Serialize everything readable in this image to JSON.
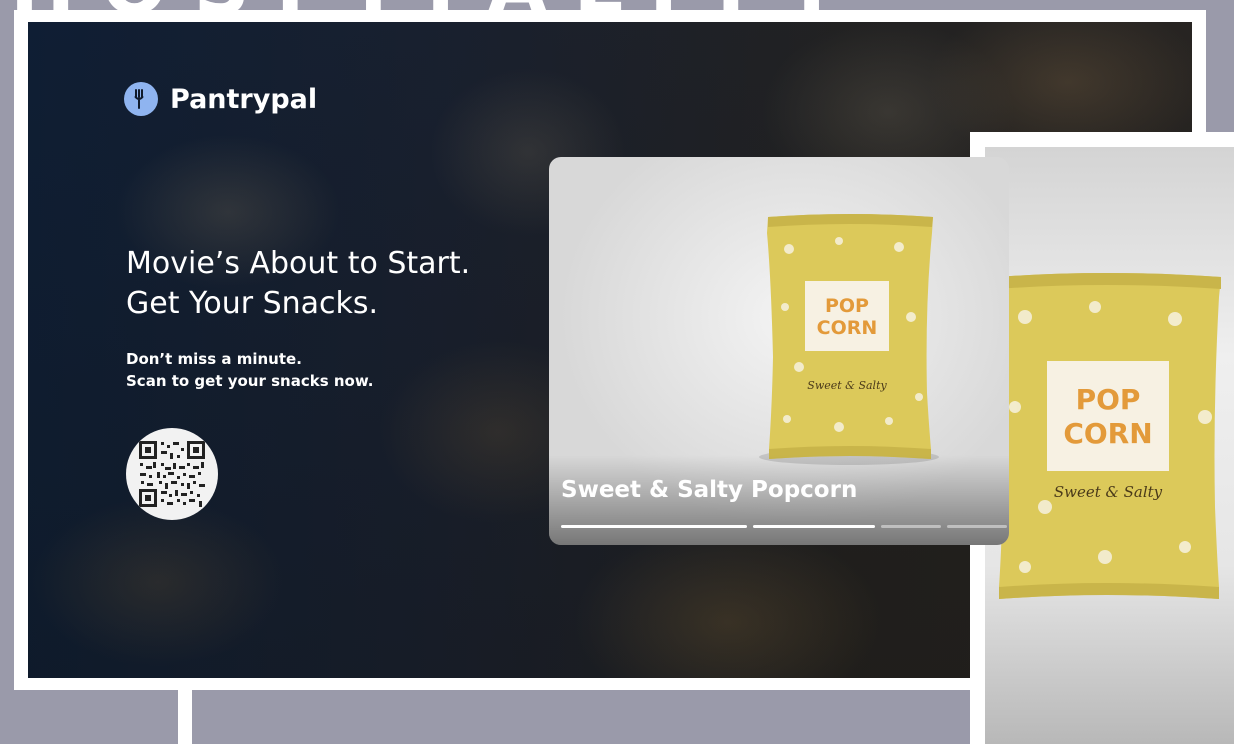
{
  "banner": {
    "text": "HOSPITALITY"
  },
  "brand": {
    "name": "Pantrypal",
    "icon": "fork-icon",
    "color": "#8fb4f0"
  },
  "hero": {
    "headline_line1": "Movie’s About to Start.",
    "headline_line2": "Get Your Snacks.",
    "sub_line1": "Don’t miss a minute.",
    "sub_line2": "Scan to get your snacks now."
  },
  "qr": {
    "icon": "qr-code-icon"
  },
  "product_card": {
    "title": "Sweet & Salty Popcorn",
    "carousel": {
      "segments": 4,
      "active_index": 1
    },
    "bag": {
      "line1": "POP",
      "line2": "CORN",
      "tagline": "Sweet & Salty"
    }
  },
  "side_preview": {
    "bag": {
      "line1": "POP",
      "line2": "CORN",
      "tagline": "Sweet & Salty"
    }
  },
  "colors": {
    "bag_yellow": "#dcc95a",
    "bag_text_orange": "#e39a3a"
  }
}
